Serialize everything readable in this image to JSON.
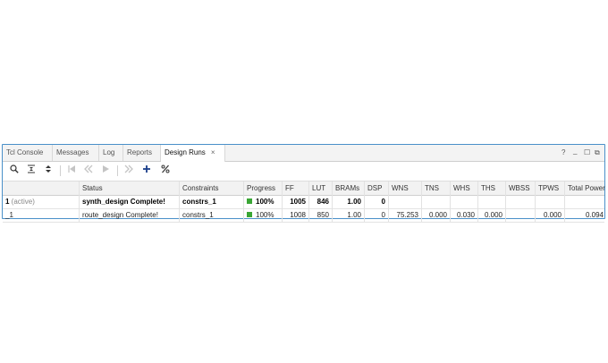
{
  "tabs": [
    {
      "label": "Tcl Console"
    },
    {
      "label": "Messages"
    },
    {
      "label": "Log"
    },
    {
      "label": "Reports"
    },
    {
      "label": "Design Runs",
      "active": true
    }
  ],
  "tab_close": "×",
  "window_controls": {
    "help": "?",
    "minimize": "_",
    "restore": "☐",
    "popout": "⧉"
  },
  "toolbar_icons": [
    "search-icon",
    "collapse-all-icon",
    "expand-all-icon",
    "reset-runs-icon",
    "previous-icon",
    "run-icon",
    "next-icon",
    "add-icon",
    "percent-icon"
  ],
  "table": {
    "columns": [
      "Status",
      "Constraints",
      "Progress",
      "FF",
      "LUT",
      "BRAMs",
      "DSP",
      "WNS",
      "TNS",
      "WHS",
      "THS",
      "WBSS",
      "TPWS",
      "Total Power"
    ],
    "rows": [
      {
        "name": "1",
        "name_suffix": " (active)",
        "status": "synth_design Complete!",
        "constraints": "constrs_1",
        "progress": "100%",
        "progress_value": 100,
        "ff": "1005",
        "lut": "846",
        "brams": "1.00",
        "dsp": "0",
        "wns": "",
        "tns": "",
        "whs": "",
        "ths": "",
        "wbss": "",
        "tpws": "",
        "total_power": ""
      },
      {
        "name": "_1",
        "status": "route_design Complete!",
        "constraints": "constrs_1",
        "progress": "100%",
        "progress_value": 100,
        "ff": "1008",
        "lut": "850",
        "brams": "1.00",
        "dsp": "0",
        "wns": "75.253",
        "tns": "0.000",
        "whs": "0.030",
        "ths": "0.000",
        "wbss": "",
        "tpws": "0.000",
        "total_power": "0.094"
      }
    ]
  },
  "colors": {
    "accent_border": "#4a90c9",
    "progress_fill": "#3aa635"
  }
}
